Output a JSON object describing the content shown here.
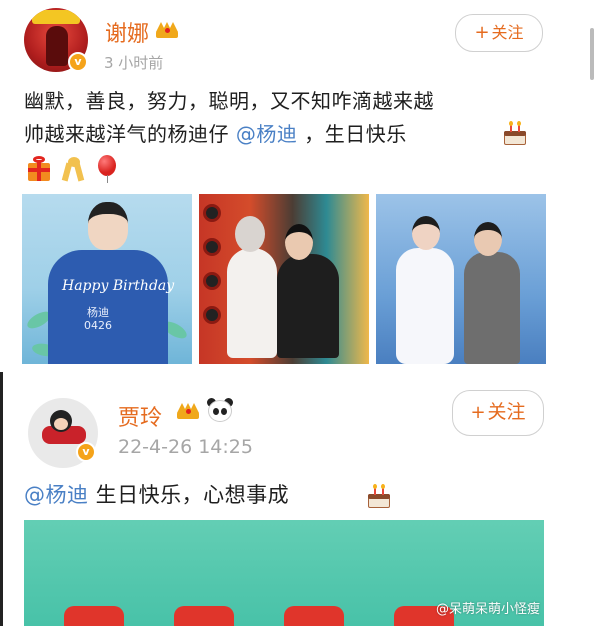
{
  "post1": {
    "author": "谢娜",
    "time": "3 小时前",
    "follow_label": "关注",
    "follow_plus": "+",
    "text_line1": "幽默，善良，努力，聪明，又不知咋滴越来越",
    "text_line2_before": "帅越来越洋气的杨迪仔 ",
    "mention": "@杨迪",
    "text_line2_after": " ，生日快乐",
    "photo1_caption": "Happy Birthday",
    "photo1_signature": "杨迪\n0426"
  },
  "post2": {
    "author": "贾玲",
    "time": "22-4-26 14:25",
    "follow_label": "关注",
    "follow_plus": "+",
    "mention": "@杨迪",
    "text_after": " 生日快乐，心想事成"
  },
  "watermark": "@呆萌呆萌小怪瘦",
  "colors": {
    "name": "#e56b1f",
    "mention": "#4a80c5",
    "time": "#a6a6a6",
    "verified": "#f5a31a"
  },
  "icons": {
    "verified": "v-badge-icon",
    "crown": "crown-icon",
    "panda": "panda-icon",
    "cake": "birthday-cake-icon",
    "gift": "gift-icon",
    "ribbon": "ribbon-icon",
    "balloon": "balloon-icon"
  }
}
